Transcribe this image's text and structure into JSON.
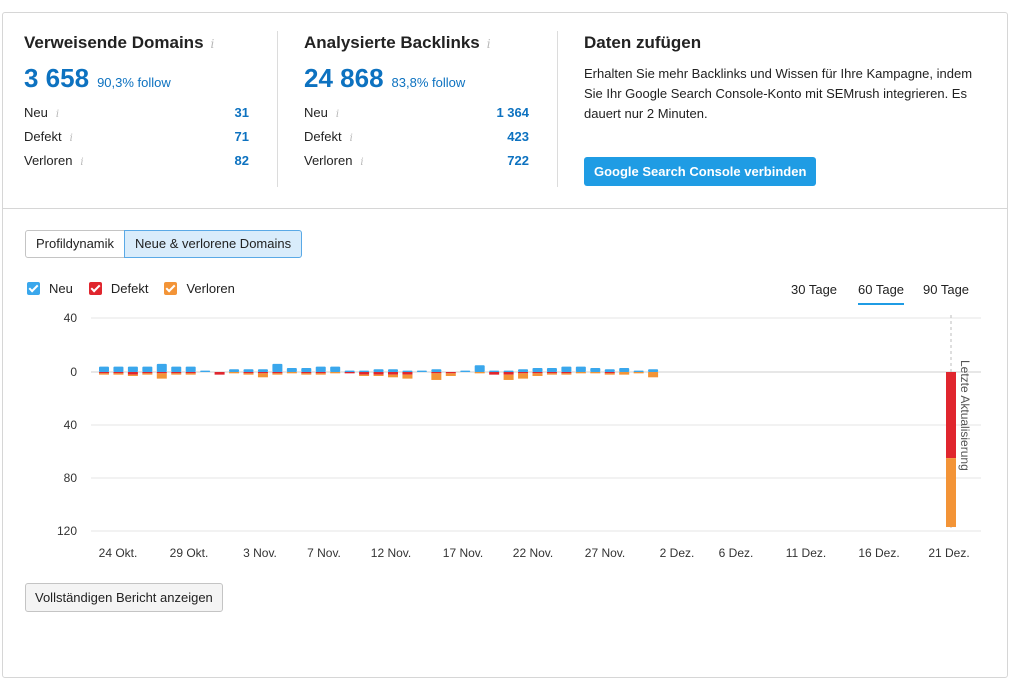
{
  "referring_domains": {
    "title": "Verweisende Domains",
    "info_icon": "i",
    "total": "3 658",
    "follow": "90,3% follow",
    "rows": [
      {
        "label": "Neu",
        "value": "31"
      },
      {
        "label": "Defekt",
        "value": "71"
      },
      {
        "label": "Verloren",
        "value": "82"
      }
    ]
  },
  "backlinks": {
    "title": "Analysierte Backlinks",
    "info_icon": "i",
    "total": "24 868",
    "follow": "83,8% follow",
    "rows": [
      {
        "label": "Neu",
        "value": "1 364"
      },
      {
        "label": "Defekt",
        "value": "423"
      },
      {
        "label": "Verloren",
        "value": "722"
      }
    ]
  },
  "add_data": {
    "title": "Daten zufügen",
    "description": "Erhalten Sie mehr Backlinks und Wissen für Ihre Kampagne, indem Sie Ihr Google Search Console-Konto mit SEMrush integrieren. Es dauert nur 2 Minuten.",
    "button": "Google Search Console verbinden"
  },
  "tabs": [
    {
      "label": "Profildynamik",
      "active": false
    },
    {
      "label": "Neue & verlorene Domains",
      "active": true
    }
  ],
  "legend": [
    {
      "label": "Neu",
      "color": "#3aa7ec"
    },
    {
      "label": "Defekt",
      "color": "#e0262e"
    },
    {
      "label": "Verloren",
      "color": "#f39437"
    }
  ],
  "periods": [
    {
      "label": "30 Tage",
      "active": false
    },
    {
      "label": "60 Tage",
      "active": true
    },
    {
      "label": "90 Tage",
      "active": false
    }
  ],
  "report_button": "Vollständigen Bericht anzeigen",
  "chart_data": {
    "type": "bar",
    "y_tick_labels": [
      "40",
      "0",
      "40",
      "80",
      "120"
    ],
    "y_tick_values": [
      40,
      0,
      -40,
      -80,
      -120
    ],
    "ylim": [
      -120,
      40
    ],
    "x_tick_labels": [
      "24 Okt.",
      "29 Okt.",
      "3 Nov.",
      "7 Nov.",
      "12 Nov.",
      "17 Nov.",
      "22 Nov.",
      "27 Nov.",
      "2 Dez.",
      "6 Dez.",
      "11 Dez.",
      "16 Dez.",
      "21 Dez."
    ],
    "annotation": "Letzte Aktualisierung",
    "series_order": [
      "Neu",
      "Defekt",
      "Verloren"
    ],
    "days": [
      {
        "new": 4,
        "broken": 1,
        "lost": 1
      },
      {
        "new": 4,
        "broken": 1,
        "lost": 1
      },
      {
        "new": 4,
        "broken": 2,
        "lost": 1
      },
      {
        "new": 4,
        "broken": 1,
        "lost": 1
      },
      {
        "new": 6,
        "broken": 1,
        "lost": 4
      },
      {
        "new": 4,
        "broken": 1,
        "lost": 1
      },
      {
        "new": 4,
        "broken": 1,
        "lost": 1
      },
      {
        "new": 1,
        "broken": 0,
        "lost": 0
      },
      {
        "new": 0,
        "broken": 2,
        "lost": 0
      },
      {
        "new": 2,
        "broken": 0,
        "lost": 1
      },
      {
        "new": 2,
        "broken": 1,
        "lost": 1
      },
      {
        "new": 2,
        "broken": 1,
        "lost": 3
      },
      {
        "new": 6,
        "broken": 1,
        "lost": 1
      },
      {
        "new": 3,
        "broken": 0,
        "lost": 1
      },
      {
        "new": 3,
        "broken": 1,
        "lost": 1
      },
      {
        "new": 4,
        "broken": 1,
        "lost": 1
      },
      {
        "new": 4,
        "broken": 0,
        "lost": 1
      },
      {
        "new": 1,
        "broken": 1,
        "lost": 0
      },
      {
        "new": 1,
        "broken": 2,
        "lost": 1
      },
      {
        "new": 2,
        "broken": 2,
        "lost": 1
      },
      {
        "new": 2,
        "broken": 2,
        "lost": 2
      },
      {
        "new": 1,
        "broken": 2,
        "lost": 3
      },
      {
        "new": 1,
        "broken": 0,
        "lost": 0
      },
      {
        "new": 2,
        "broken": 1,
        "lost": 5
      },
      {
        "new": 0,
        "broken": 1,
        "lost": 2
      },
      {
        "new": 1,
        "broken": 0,
        "lost": 0
      },
      {
        "new": 5,
        "broken": 0,
        "lost": 1
      },
      {
        "new": 1,
        "broken": 2,
        "lost": 0
      },
      {
        "new": 1,
        "broken": 2,
        "lost": 4
      },
      {
        "new": 2,
        "broken": 1,
        "lost": 4
      },
      {
        "new": 3,
        "broken": 1,
        "lost": 2
      },
      {
        "new": 3,
        "broken": 1,
        "lost": 1
      },
      {
        "new": 4,
        "broken": 1,
        "lost": 1
      },
      {
        "new": 4,
        "broken": 0,
        "lost": 1
      },
      {
        "new": 3,
        "broken": 0,
        "lost": 1
      },
      {
        "new": 2,
        "broken": 1,
        "lost": 1
      },
      {
        "new": 3,
        "broken": 0,
        "lost": 2
      },
      {
        "new": 1,
        "broken": 0,
        "lost": 1
      },
      {
        "new": 2,
        "broken": 0,
        "lost": 4
      }
    ],
    "last_update": {
      "new": 0,
      "broken": 65,
      "lost": 52
    }
  }
}
